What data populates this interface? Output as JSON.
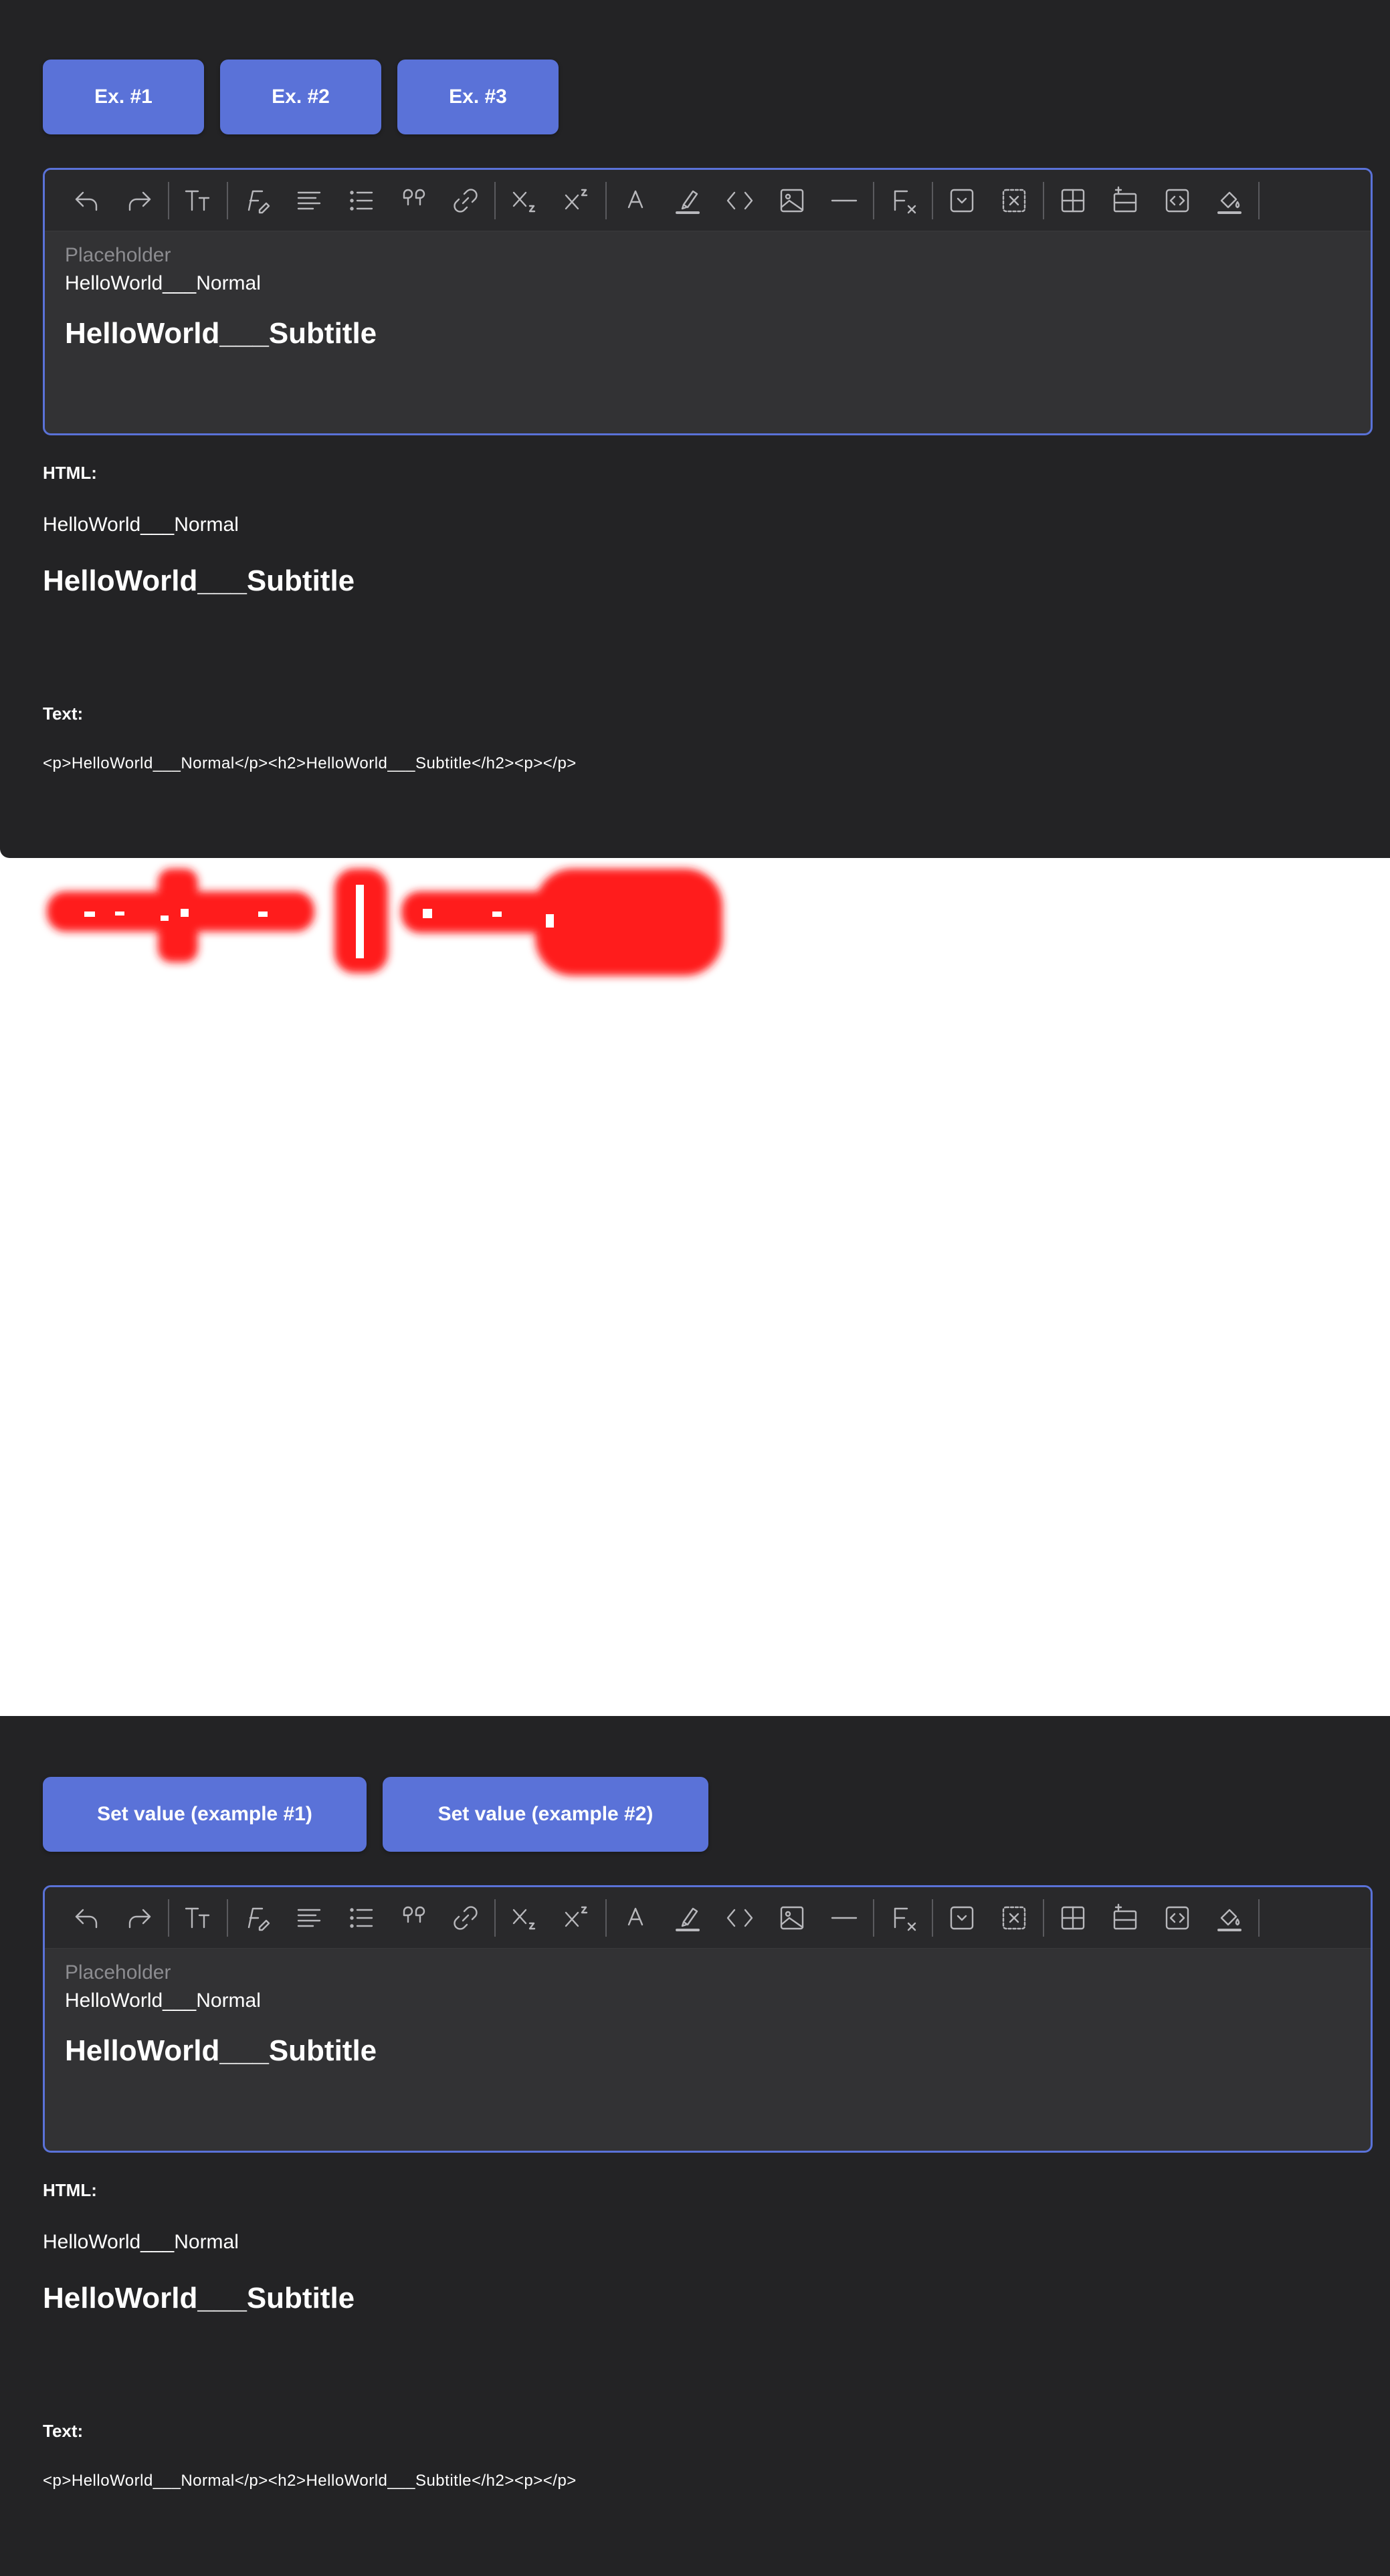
{
  "top_demo": {
    "buttons": [
      "Ex. #1",
      "Ex. #2",
      "Ex. #3"
    ],
    "editor": {
      "placeholder": "Placeholder",
      "normal": "HelloWorld___Normal",
      "subtitle": "HelloWorld___Subtitle"
    },
    "html_label": "HTML:",
    "html_normal": "HelloWorld___Normal",
    "html_subtitle": "HelloWorld___Subtitle",
    "text_label": "Text:",
    "text_value": "<p>HelloWorld___Normal</p><h2>HelloWorld___Subtitle</h2><p></p>"
  },
  "bottom_demo": {
    "buttons": [
      "Set value (example #1)",
      "Set value (example #2)"
    ],
    "editor": {
      "placeholder": "Placeholder",
      "normal": "HelloWorld___Normal",
      "subtitle": "HelloWorld___Subtitle"
    },
    "html_label": "HTML:",
    "html_normal": "HelloWorld___Normal",
    "html_subtitle": "HelloWorld___Subtitle",
    "text_label": "Text:",
    "text_value": "<p>HelloWorld___Normal</p><h2>HelloWorld___Subtitle</h2><p></p>"
  },
  "toolbar_icons": [
    "undo-icon",
    "redo-icon",
    "font-size-icon",
    "font-style-icon",
    "align-icon",
    "list-icon",
    "quote-icon",
    "link-icon",
    "subscript-icon",
    "superscript-icon",
    "font-color-icon",
    "highlight-icon",
    "code-icon",
    "image-icon",
    "horizontal-rule-icon",
    "clear-format-icon",
    "details-icon",
    "remove-details-icon",
    "table-icon",
    "insert-row-icon",
    "embed-code-icon",
    "fill-color-icon"
  ],
  "colors": {
    "panel": "#232325",
    "accent": "#5a72d8",
    "editor_bg": "#323234",
    "toolbar_bg": "#29292b",
    "artifact_red": "#ff1a1a"
  }
}
